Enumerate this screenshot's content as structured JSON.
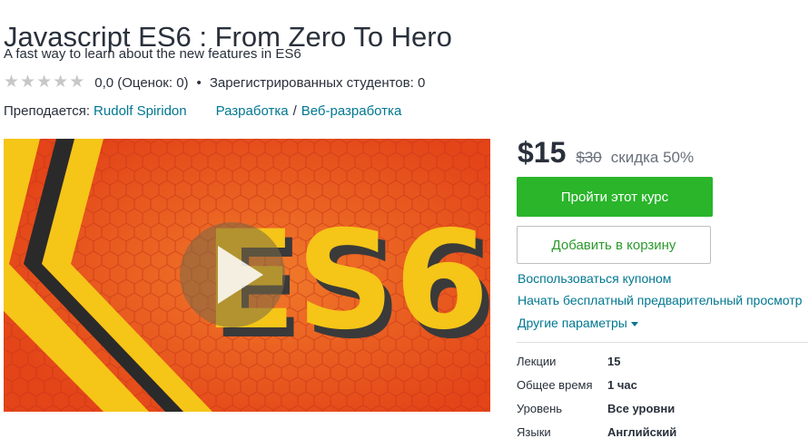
{
  "course": {
    "title": "Javascript ES6 : From Zero To Hero",
    "subtitle": "A fast way to learn about the new features in ES6",
    "rating_value": "0,0 (Оценок: 0)",
    "separator": "•",
    "students": "Зарегистрированных студентов: 0",
    "taught_by_label": "Преподается:",
    "instructor": "Rudolf Spiridon",
    "category": "Разработка",
    "category_sep": "/",
    "subcategory": "Веб-разработка",
    "rating_stars": 0,
    "stars_total": 5
  },
  "video": {
    "thumbnail_text": "ES6",
    "play_icon": "play-icon"
  },
  "pricing": {
    "price": "$15",
    "old_price": "$30",
    "discount": "скидка 50%",
    "buy_label": "Пройти этот курс",
    "cart_label": "Добавить в корзину",
    "coupon_link": "Воспользоваться купоном",
    "preview_link": "Начать бесплатный предварительный просмотр",
    "more_options": "Другие параметры"
  },
  "details": [
    {
      "label": "Лекции",
      "value": "15"
    },
    {
      "label": "Общее время",
      "value": "1 час"
    },
    {
      "label": "Уровень",
      "value": "Все уровни"
    },
    {
      "label": "Языки",
      "value": "Английский"
    }
  ],
  "colors": {
    "accent_green": "#2ab52a",
    "link": "#007791",
    "thumbnail_orange": "#e8491d",
    "thumbnail_yellow": "#f5c518"
  }
}
